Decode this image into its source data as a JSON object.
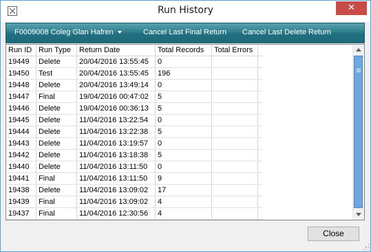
{
  "window": {
    "title": "Run History",
    "close_glyph": "✕"
  },
  "toolbar": {
    "provider_label": "F0009008 Coleg Glan Hafren",
    "cancel_final_label": "Cancel Last Final Return",
    "cancel_delete_label": "Cancel Last Delete Return"
  },
  "table": {
    "columns": [
      "Run ID",
      "Run Type",
      "Return Date",
      "Total Records",
      "Total Errors"
    ],
    "rows": [
      [
        "19449",
        "Delete",
        "20/04/2016 13:55:45",
        "0",
        ""
      ],
      [
        "19450",
        "Test",
        "20/04/2016 13:55:45",
        "196",
        ""
      ],
      [
        "19448",
        "Delete",
        "20/04/2016 13:49:14",
        "0",
        ""
      ],
      [
        "19447",
        "Final",
        "19/04/2016 00:47:02",
        "5",
        ""
      ],
      [
        "19446",
        "Delete",
        "19/04/2016 00:36:13",
        "5",
        ""
      ],
      [
        "19445",
        "Delete",
        "11/04/2016 13:22:54",
        "0",
        ""
      ],
      [
        "19444",
        "Delete",
        "11/04/2016 13:22:38",
        "5",
        ""
      ],
      [
        "19443",
        "Delete",
        "11/04/2016 13:19:57",
        "0",
        ""
      ],
      [
        "19442",
        "Delete",
        "11/04/2016 13:18:38",
        "5",
        ""
      ],
      [
        "19440",
        "Delete",
        "11/04/2016 13:11:50",
        "0",
        ""
      ],
      [
        "19441",
        "Final",
        "11/04/2016 13:11:50",
        "9",
        ""
      ],
      [
        "19438",
        "Delete",
        "11/04/2016 13:09:02",
        "17",
        ""
      ],
      [
        "19439",
        "Final",
        "11/04/2016 13:09:02",
        "4",
        ""
      ],
      [
        "19437",
        "Final",
        "11/04/2016 12:30:56",
        "4",
        ""
      ]
    ]
  },
  "footer": {
    "close_label": "Close"
  }
}
